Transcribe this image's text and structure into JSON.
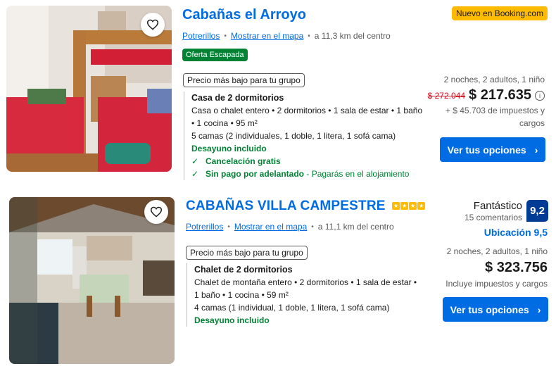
{
  "listings": [
    {
      "title": "Cabañas el Arroyo",
      "new_badge": "Nuevo en Booking.com",
      "location_link": "Potrerillos",
      "map_link": "Mostrar en el mapa",
      "distance": "a 11,3 km del centro",
      "deal_badge": "Oferta Escapada",
      "group_pill": "Precio más bajo para tu grupo",
      "room_name": "Casa de 2 dormitorios",
      "room_desc_1": "Casa o chalet entero • 2 dormitorios • 1 sala de estar • 1 baño",
      "room_desc_2": "• 1 cocina • 95 m²",
      "beds": "5 camas (2 individuales, 1 doble, 1 litera, 1 sofá cama)",
      "breakfast": "Desayuno incluido",
      "free_cancel": "Cancelación gratis",
      "no_prepay": "Sin pago por adelantado",
      "no_prepay_note": "- Pagarás en el alojamiento",
      "stay_info": "2 noches, 2 adultos, 1 niño",
      "old_price": "$ 272.044",
      "price": "$ 217.635",
      "taxes": "+ $ 45.703 de impuestos y",
      "taxes_2": "cargos",
      "cta_label": "Ver tus opciones"
    },
    {
      "title": "CABAÑAS VILLA CAMPESTRE",
      "stars": 4,
      "location_link": "Potrerillos",
      "map_link": "Mostrar en el mapa",
      "distance": "a 11,1 km del centro",
      "group_pill": "Precio más bajo para tu grupo",
      "room_name": "Chalet de 2 dormitorios",
      "room_desc_1": "Chalet de montaña entero • 2 dormitorios • 1 sala de estar •",
      "room_desc_2": "1 baño • 1 cocina • 59 m²",
      "beds": "4 camas (1 individual, 1 doble, 1 litera, 1 sofá cama)",
      "breakfast": "Desayuno incluido",
      "review_word": "Fantástico",
      "review_count": "15 comentarios",
      "score": "9,2",
      "location_score": "Ubicación 9,5",
      "stay_info": "2 noches, 2 adultos, 1 niño",
      "price": "$ 323.756",
      "taxes": "Incluye impuestos y cargos",
      "cta_label": "Ver tus opciones"
    }
  ],
  "colors": {
    "link": "#006ce4",
    "green": "#008234",
    "cta": "#006ce4",
    "badge_yellow": "#febb02",
    "score_bg": "#003b95",
    "strike": "#d4111e"
  }
}
